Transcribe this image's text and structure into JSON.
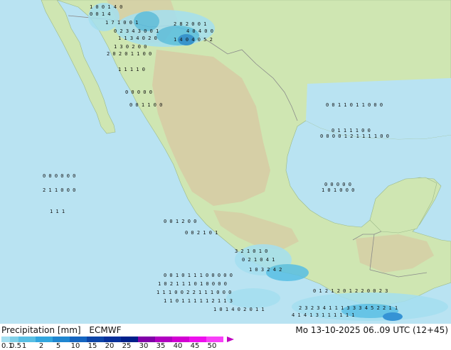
{
  "header": {
    "title": "Precipitation [mm]",
    "model": "ECMWF",
    "valid_time": "Mo 13-10-2025 06..09 UTC (12+45)"
  },
  "legend": {
    "ticks": [
      "0.1",
      "0.5",
      "1",
      "2",
      "5",
      "10",
      "15",
      "20",
      "25",
      "30",
      "35",
      "40",
      "45",
      "50"
    ],
    "colors": [
      "#a4dff0",
      "#80d0e8",
      "#58bfe4",
      "#32a6de",
      "#1f86d0",
      "#1565c0",
      "#0d45a8",
      "#07309a",
      "#001f8a",
      "#8000a8",
      "#b000c0",
      "#d200d2",
      "#ee10ee",
      "#f840f8"
    ]
  },
  "map": {
    "land_color": "#cfe6b2",
    "land_dark": "#b8d69a",
    "highland_color": "#d7c9a3",
    "ocean_color": "#b9e3f2",
    "border_color": "#8a8a8a",
    "rain_light": "#a4dff0",
    "rain_mid": "#58bfe4",
    "rain_heavy": "#1f86d0",
    "precip_rows": [
      "1 0 0 1 4 0",
      "0 0 1 4",
      "1 7 1 0 0 1",
      "0 2 3 4 3 0 0 1",
      "1 1 3 4 0 2 0",
      "1 3 0 2 0 0",
      "2 0 2 0 1 1 0 0",
      "2 8 2 0 0 1",
      "4 0 4 0 0",
      "1 4 0 4 0 5 2",
      "1 1 1 1 0",
      "0 0 0 0 0",
      "0 0 1 1 0 0",
      "0 0 1 1 0 1 1 0 0 0",
      "0 0 0 0 1 2 1 1 1 1 0 0",
      "0 1 1 1 1 0 0",
      "0 0 0 0 0",
      "1 0 1 0 0 0",
      "0 0 0 0 0 0",
      "2 1 1 0 0 0",
      "1 1 1",
      "0 0 1 2 0 0",
      "0 0 2 1 0 1",
      "3 2 1 0 1 0",
      "0 2 1 0 4 1",
      "1 0 3 2 4 2",
      "0 0 1 0 1 1 1 0 0 0 0 0",
      "1 0 2 1 1 1 0 1 0 0 0 0",
      "1 1 1 0 0 2 2 1 1 1 0 0 0",
      "1 1 0 1 1 1 1 1 2 1 1 3",
      "1 0 1 4 0 2 0 1 1",
      "0 1 2 1 2 0 1 2 2 0 0 2 3",
      "2 3 2 3 4 1 1 1 3 3 3 4 5 2 2 1 1",
      "4 1 4 1 3 1 1 1 1 1 1"
    ]
  }
}
